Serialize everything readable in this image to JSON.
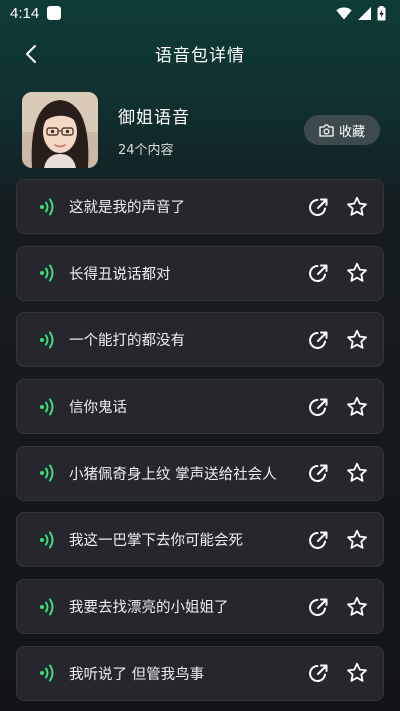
{
  "status_bar": {
    "time": "4:14"
  },
  "header": {
    "title": "语音包详情"
  },
  "pack": {
    "name": "御姐语音",
    "count_text": "24个内容",
    "collect_label": "收藏"
  },
  "colors": {
    "accent_green": "#3ddc84",
    "card_bg": "#26272d",
    "button_bg": "#3e4b4e"
  },
  "items": [
    {
      "label": "这就是我的声音了"
    },
    {
      "label": "长得丑说话都对"
    },
    {
      "label": "一个能打的都没有"
    },
    {
      "label": "信你鬼话"
    },
    {
      "label": "小猪佩奇身上纹 掌声送给社会人"
    },
    {
      "label": "我这一巴掌下去你可能会死"
    },
    {
      "label": "我要去找漂亮的小姐姐了"
    },
    {
      "label": "我听说了 但管我鸟事"
    }
  ]
}
